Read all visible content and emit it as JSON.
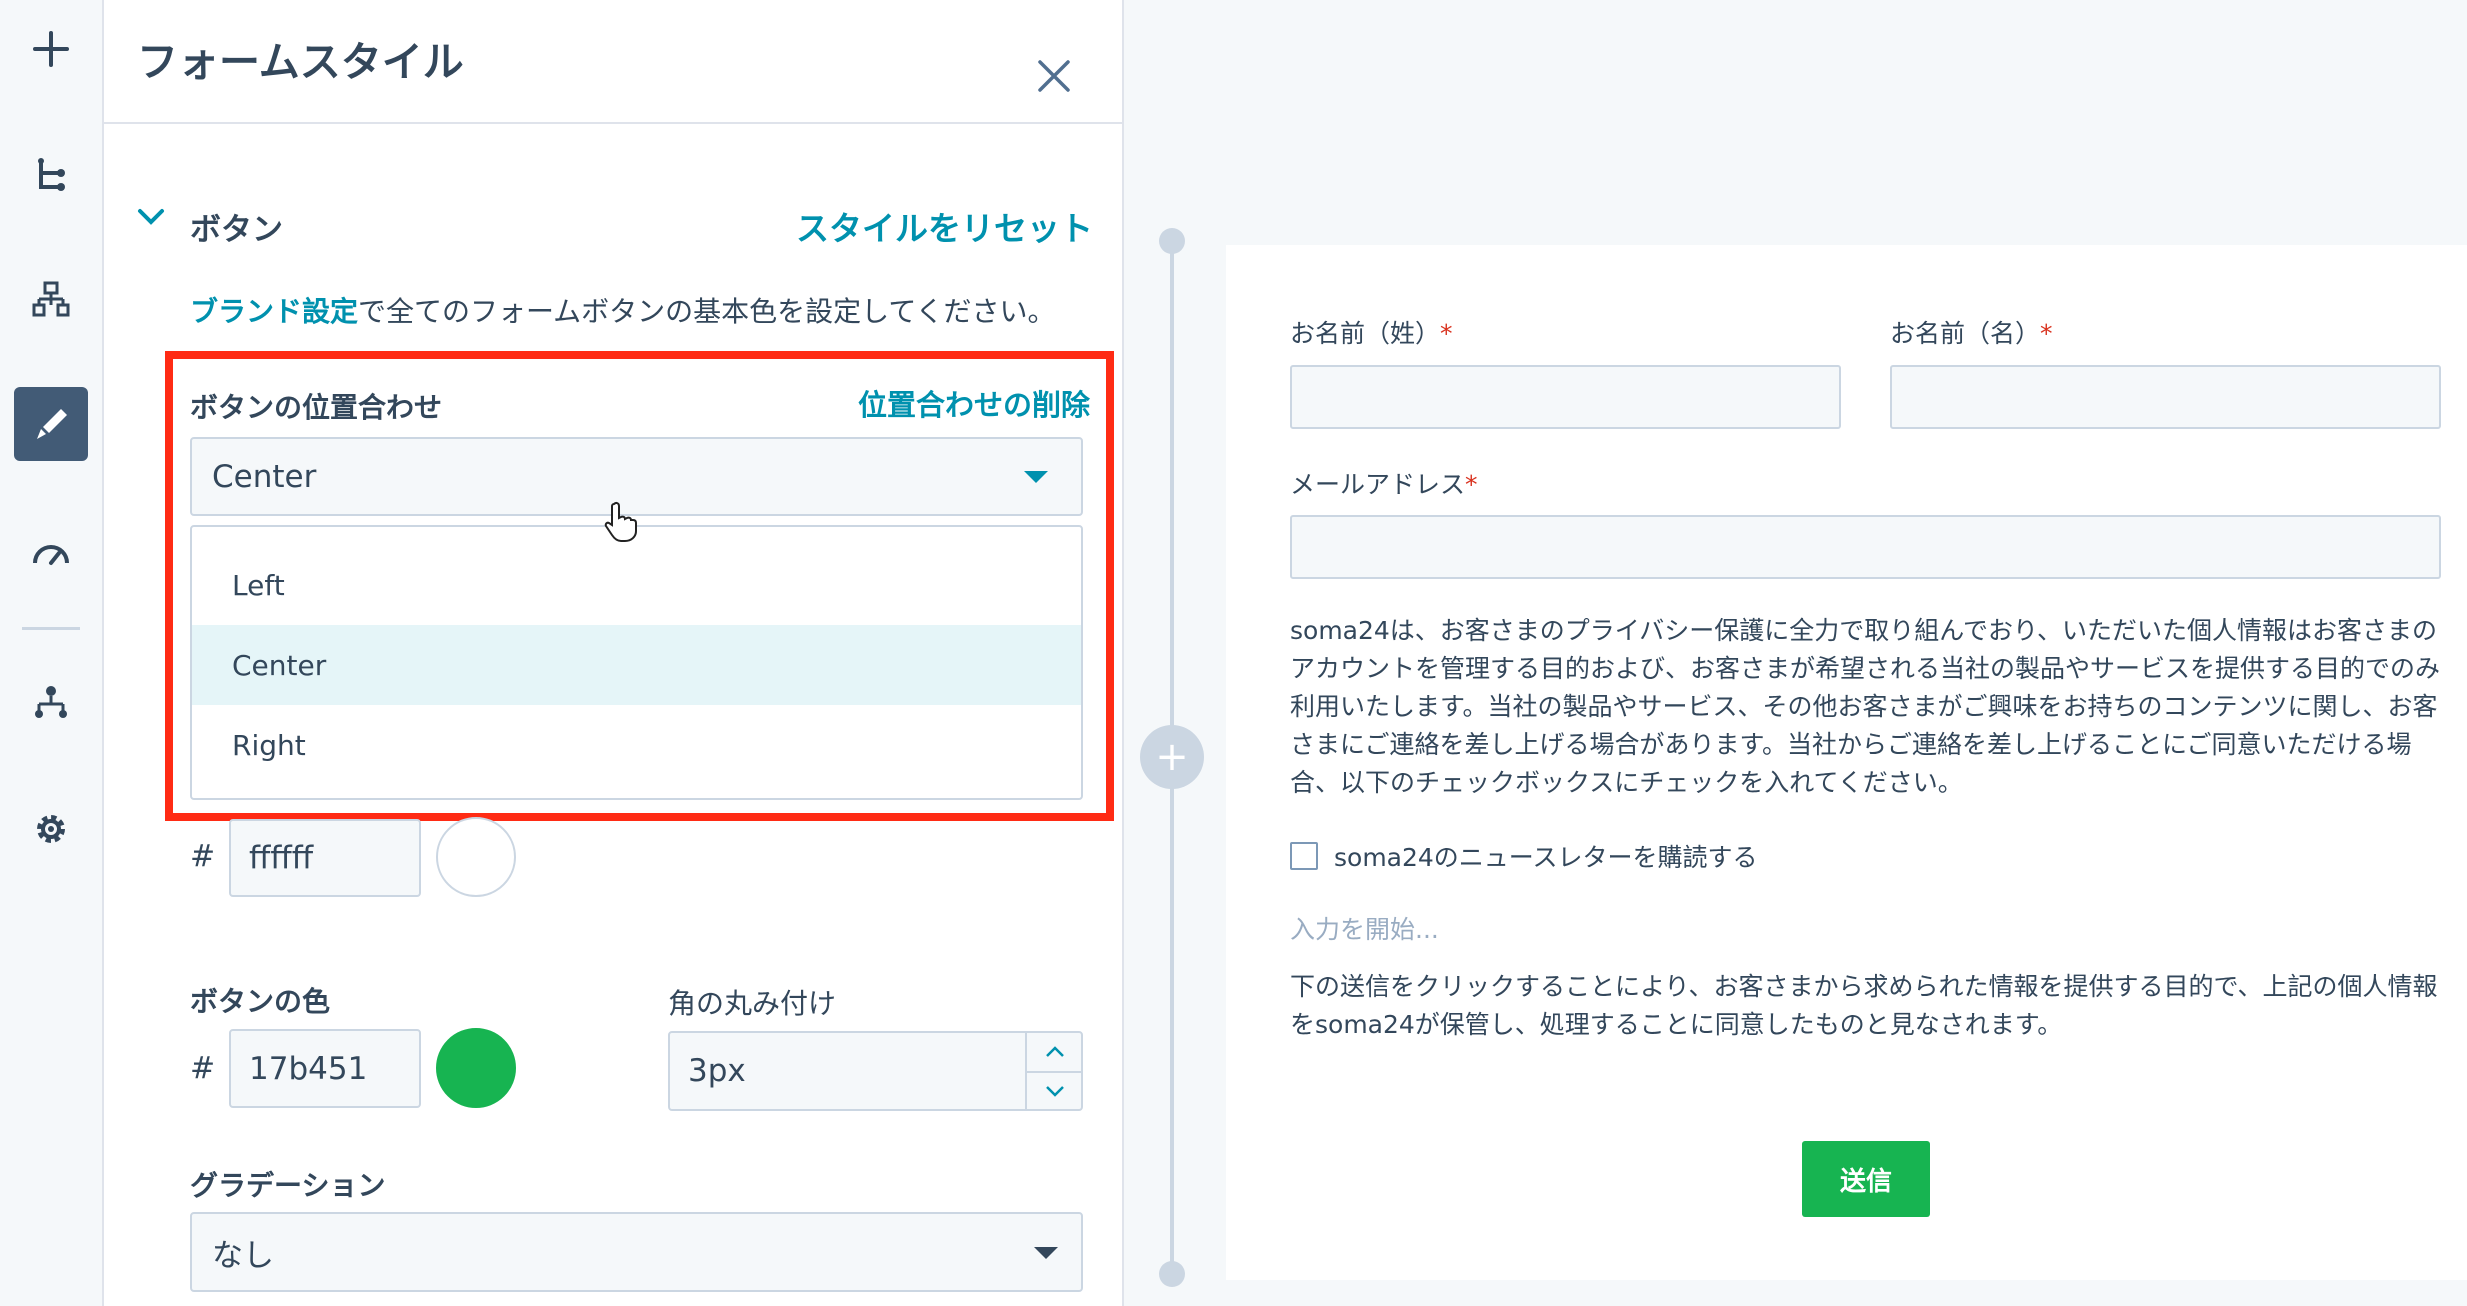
{
  "rail": {
    "items": [
      "add-icon",
      "tree-icon",
      "sitemap-icon",
      "brush-icon",
      "gauge-icon",
      "network-icon",
      "gear-icon"
    ],
    "active": "brush-icon"
  },
  "panel": {
    "title": "フォームスタイル",
    "section_title": "ボタン",
    "reset_label": "スタイルをリセット",
    "help_link": "ブランド設定",
    "help_rest": "で全てのフォームボタンの基本色を設定してください。",
    "alignment": {
      "label": "ボタンの位置合わせ",
      "clear_label": "位置合わせの削除",
      "value": "Center",
      "options": [
        "Left",
        "Center",
        "Right"
      ]
    },
    "text_color": {
      "hash": "#",
      "value": "ffffff",
      "swatch": "#ffffff"
    },
    "button_color": {
      "label": "ボタンの色",
      "hash": "#",
      "value": "17b451",
      "swatch": "#17b451"
    },
    "corner_radius": {
      "label": "角の丸み付け",
      "value": "3px"
    },
    "gradient": {
      "label": "グラデーション",
      "value": "なし"
    }
  },
  "form": {
    "last_name_label": "お名前（姓）",
    "first_name_label": "お名前（名）",
    "email_label": "メールアドレス",
    "required_mark": "*",
    "privacy_text": "soma24は、お客さまのプライバシー保護に全力で取り組んでおり、いただいた個人情報はお客さまのアカウントを管理する目的および、お客さまが希望される当社の製品やサービスを提供する目的でのみ利用いたします。当社の製品やサービス、その他お客さまがご興味をお持ちのコンテンツに関し、お客さまにご連絡を差し上げる場合があります。当社からご連絡を差し上げることにご同意いただける場合、以下のチェックボックスにチェックを入れてください。",
    "newsletter_label": "soma24のニュースレターを購読する",
    "placeholder": "入力を開始...",
    "consent_text": "下の送信をクリックすることにより、お客さまから求められた情報を提供する目的で、上記の個人情報をsoma24が保管し、処理することに同意したものと見なされます。",
    "submit_label": "送信"
  },
  "colors": {
    "accent": "#0091ae",
    "highlight": "#ff2b14",
    "submit": "#17b451",
    "selected_option": "#e5f5f8"
  }
}
